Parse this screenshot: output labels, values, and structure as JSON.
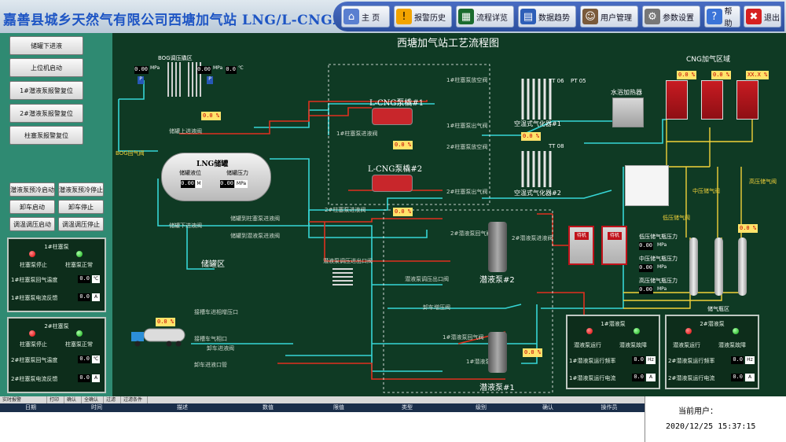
{
  "header": {
    "title": "嘉善县城乡天然气有限公司西塘加气站 LNG/L-CNG站控系统",
    "nav": [
      {
        "label": "主  页",
        "icon": "home-icon"
      },
      {
        "label": "报警历史",
        "icon": "warning-icon"
      },
      {
        "label": "流程详览",
        "icon": "process-monitor-icon"
      },
      {
        "label": "数据趋势",
        "icon": "trend-chart-icon"
      },
      {
        "label": "用户管理",
        "icon": "user-icon"
      },
      {
        "label": "参数设置",
        "icon": "gear-icon"
      },
      {
        "label": "帮助",
        "icon": "help-icon"
      },
      {
        "label": "退出",
        "icon": "close-icon"
      }
    ]
  },
  "left_panel": {
    "buttons": [
      "储罐下进液",
      "上位机启动",
      "1#潜液泵报警复位",
      "2#潜液泵报警复位",
      "柱塞泵报警复位"
    ],
    "ctrl_buttons": [
      "潜液泵预冷启动",
      "潜液泵预冷停止",
      "卸车启动",
      "卸车停止",
      "调温调压启动",
      "调温调压停止"
    ],
    "pump1": {
      "title": "1#柱塞泵",
      "stop": "柱塞泵停止",
      "normal": "柱塞泵正常",
      "temp_label": "1#柱塞泵回气温度",
      "temp": "0.0",
      "temp_unit": "℃",
      "current_label": "1#柱塞泵电流反馈",
      "current": "0.0",
      "current_unit": "A"
    },
    "pump2": {
      "title": "2#柱塞泵",
      "stop": "柱塞泵停止",
      "normal": "柱塞泵正常",
      "temp_label": "2#柱塞泵回气温度",
      "temp": "0.0",
      "temp_unit": "℃",
      "current_label": "2#柱塞泵电流反馈",
      "current": "0.0",
      "current_unit": "A"
    }
  },
  "diagram": {
    "title": "西塘加气站工艺流程图",
    "bog_area": "BOG调压撬区",
    "bog_valve": "BOG回气阀",
    "lng_tank": {
      "title": "LNG储罐",
      "level_label": "储罐液位",
      "pressure_label": "储罐压力",
      "level": "0.00",
      "level_unit": "M",
      "pressure": "0.00",
      "pressure_unit": "MPa",
      "percent": "0.0 %"
    },
    "tank_area": "储罐区",
    "pipes": {
      "top_in": "储罐上进液阀",
      "bottom_in": "储罐下进液阀",
      "to_plunger": "储罐到柱塞泵进液阀",
      "to_submerged": "储罐到潜液泵进液阀",
      "sub_return": "潜液泵调压进出口阀",
      "sub_return2": "潜液泵调压出口阀",
      "unload_boost": "卸车增压阀",
      "sub2_return_gas": "2#潜液泵回气阀",
      "sub2_in": "2#潜液泵进液阀",
      "sub1_return_gas": "1#潜液泵回气阀",
      "sub1_in": "1#潜液泵进液阀",
      "p1_vent": "1#柱塞泵放空阀",
      "p1_out": "1#柱塞泵出气阀",
      "p1_in": "1#柱塞泵进液阀",
      "p2_vent": "2#柱塞泵放空阀",
      "p2_out": "2#柱塞泵出气阀",
      "p2_in": "2#柱塞泵进液阀",
      "truck_boost": "接槽车进相增压口",
      "truck_gas": "接槽车气相口",
      "truck_in": "卸车进液阀",
      "truck_pipe": "卸车进液口管"
    },
    "lcng1": "L-CNG泵橇#1",
    "lcng2": "L-CNG泵橇#2",
    "vap1": "空温式气化器#1",
    "vap2": "空温式气化器#2",
    "water_heater": "水浴加热器",
    "cng_area": "CNG加气区域",
    "cng_dispenser_pct": [
      "0.0 %",
      "0.0 %",
      "XX.X %"
    ],
    "sub_pump1": "潜液泵#1",
    "sub_pump2": "潜液泵#2",
    "tt06": "TT 06",
    "pt05": "PT 05",
    "tt08": "TT 08",
    "storage_area": "储气瓶区",
    "low_valve": "低压储气阀",
    "mid_valve": "中压储气阀",
    "high_valve": "高压储气阀",
    "storage_pressures": [
      {
        "label": "低压储气瓶压力",
        "value": "0.00",
        "unit": "MPa"
      },
      {
        "label": "中压储气瓶压力",
        "value": "0.00",
        "unit": "MPa"
      },
      {
        "label": "高压储气瓶压力",
        "value": "0.00",
        "unit": "MPa"
      }
    ],
    "dispenser_status": [
      "待机",
      "待机"
    ],
    "sub_panel1": {
      "title": "1#潜液泵",
      "run": "潜液泵运行",
      "fault": "潜液泵故障",
      "freq_label": "1#潜液泵运行频率",
      "freq": "0.0",
      "freq_unit": "Hz",
      "cur_label": "1#潜液泵运行电流",
      "cur": "0.0",
      "cur_unit": "A"
    },
    "sub_panel2": {
      "title": "2#潜液泵",
      "run": "潜液泵运行",
      "fault": "潜液泵故障",
      "freq_label": "2#潜液泵运行频率",
      "freq": "0.0",
      "freq_unit": "Hz",
      "cur_label": "2#潜液泵运行电流",
      "cur": "0.0",
      "cur_unit": "A"
    },
    "readings": {
      "zero": "0.0",
      "zero2": "0.00",
      "mpa": "MPa",
      "degc": "℃",
      "pct0": "0.0 %"
    }
  },
  "alarm": {
    "tabs": [
      "实时报警",
      "打印",
      "确认",
      "全确认",
      "过滤",
      "过滤条件"
    ],
    "columns": [
      "日期",
      "时间",
      "描述",
      "数值",
      "限值",
      "类型",
      "级别",
      "确认",
      "操作员"
    ]
  },
  "user": {
    "label": "当前用户：",
    "datetime": "2020/12/25 15:37:15"
  },
  "colors": {
    "pipe_cyan": "#36d6d6",
    "pipe_red": "#e0301e",
    "valve_red": "#e8202a",
    "bg": "#0f3a24"
  }
}
